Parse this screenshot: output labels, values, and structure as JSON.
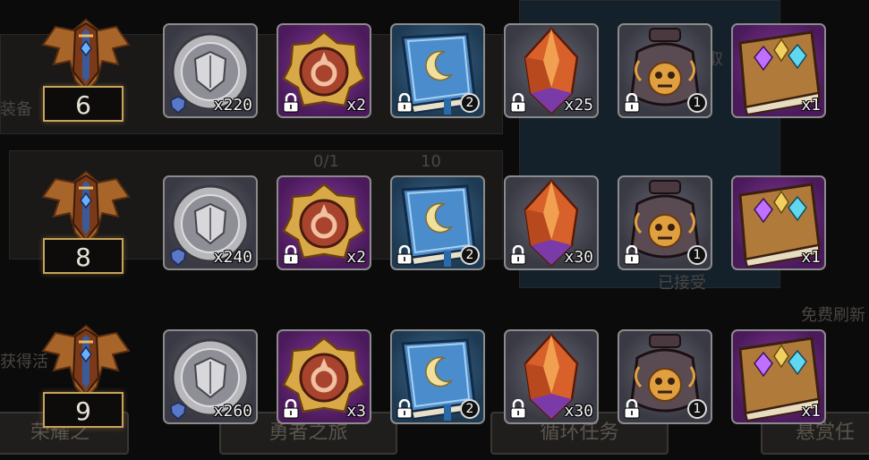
{
  "background": {
    "faded_texts": [
      "装备",
      "0/1",
      "10",
      "免费刷新",
      "获得活",
      "荣耀之",
      "勇者之旅",
      "循环任务",
      "悬赏任",
      "已接受",
      "取"
    ]
  },
  "rows": [
    {
      "level": "6",
      "items": [
        {
          "name": "silver-shield-coin",
          "rarity": "gray",
          "quantity": "x220",
          "locked": false,
          "badge": null
        },
        {
          "name": "fire-ring-emblem",
          "rarity": "purple",
          "quantity": "x2",
          "locked": true,
          "badge": null
        },
        {
          "name": "moon-book",
          "rarity": "blue",
          "quantity": null,
          "locked": true,
          "badge": "2"
        },
        {
          "name": "amber-crystal",
          "rarity": "gray",
          "quantity": "x25",
          "locked": true,
          "badge": null
        },
        {
          "name": "skull-urn",
          "rarity": "gray",
          "quantity": null,
          "locked": true,
          "badge": "1"
        },
        {
          "name": "gem-chest-book",
          "rarity": "purple",
          "quantity": "x1",
          "locked": false,
          "badge": null
        }
      ]
    },
    {
      "level": "8",
      "items": [
        {
          "name": "silver-shield-coin",
          "rarity": "gray",
          "quantity": "x240",
          "locked": false,
          "badge": null
        },
        {
          "name": "fire-ring-emblem",
          "rarity": "purple",
          "quantity": "x2",
          "locked": true,
          "badge": null
        },
        {
          "name": "moon-book",
          "rarity": "blue",
          "quantity": null,
          "locked": true,
          "badge": "2"
        },
        {
          "name": "amber-crystal",
          "rarity": "gray",
          "quantity": "x30",
          "locked": true,
          "badge": null
        },
        {
          "name": "skull-urn",
          "rarity": "gray",
          "quantity": null,
          "locked": true,
          "badge": "1"
        },
        {
          "name": "gem-chest-book",
          "rarity": "purple",
          "quantity": "x1",
          "locked": false,
          "badge": null
        }
      ]
    },
    {
      "level": "9",
      "items": [
        {
          "name": "silver-shield-coin",
          "rarity": "gray",
          "quantity": "x260",
          "locked": false,
          "badge": null
        },
        {
          "name": "fire-ring-emblem",
          "rarity": "purple",
          "quantity": "x3",
          "locked": true,
          "badge": null
        },
        {
          "name": "moon-book",
          "rarity": "blue",
          "quantity": null,
          "locked": true,
          "badge": "2"
        },
        {
          "name": "amber-crystal",
          "rarity": "gray",
          "quantity": "x30",
          "locked": true,
          "badge": null
        },
        {
          "name": "skull-urn",
          "rarity": "gray",
          "quantity": null,
          "locked": true,
          "badge": "1"
        },
        {
          "name": "gem-chest-book",
          "rarity": "purple",
          "quantity": "x1",
          "locked": false,
          "badge": null
        }
      ]
    }
  ],
  "colors": {
    "accent_gold": "#c8a35a",
    "slot_border": "#8b8b8b",
    "purple": "#6a2a80",
    "blue": "#2e5a7e"
  }
}
